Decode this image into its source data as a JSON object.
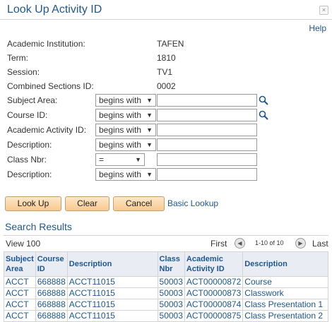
{
  "header": {
    "title": "Look Up Activity ID",
    "close_symbol": "×",
    "help": "Help"
  },
  "info": [
    {
      "label": "Academic Institution:",
      "value": "TAFEN"
    },
    {
      "label": "Term:",
      "value": "1810"
    },
    {
      "label": "Session:",
      "value": "TV1"
    },
    {
      "label": "Combined Sections ID:",
      "value": "0002"
    }
  ],
  "criteria": [
    {
      "label": "Subject Area:",
      "operator": "begins with",
      "value": "",
      "lookup": true
    },
    {
      "label": "Course ID:",
      "operator": "begins with",
      "value": "",
      "lookup": true
    },
    {
      "label": "Academic Activity ID:",
      "operator": "begins with",
      "value": "",
      "lookup": false
    },
    {
      "label": "Description:",
      "operator": "begins with",
      "value": "",
      "lookup": false
    },
    {
      "label": "Class Nbr:",
      "operator": "=",
      "value": "",
      "lookup": false
    },
    {
      "label": "Description:",
      "operator": "begins with",
      "value": "",
      "lookup": false
    }
  ],
  "buttons": {
    "lookup": "Look Up",
    "clear": "Clear",
    "cancel": "Cancel",
    "basic": "Basic Lookup"
  },
  "results": {
    "title": "Search Results",
    "view_all": "View 100",
    "first": "First",
    "range": "1-10 of 10",
    "last": "Last",
    "columns": [
      "Subject Area",
      "Course ID",
      "Description",
      "Class Nbr",
      "Academic Activity ID",
      "Description"
    ],
    "rows": [
      [
        "ACCT",
        "668888",
        "ACCT11015",
        "50003",
        "ACT00000872",
        "Course"
      ],
      [
        "ACCT",
        "668888",
        "ACCT11015",
        "50003",
        "ACT00000873",
        "Classwork"
      ],
      [
        "ACCT",
        "668888",
        "ACCT11015",
        "50003",
        "ACT00000874",
        "Class Presentation 1"
      ],
      [
        "ACCT",
        "668888",
        "ACCT11015",
        "50003",
        "ACT00000875",
        "Class Presentation 2"
      ]
    ]
  }
}
